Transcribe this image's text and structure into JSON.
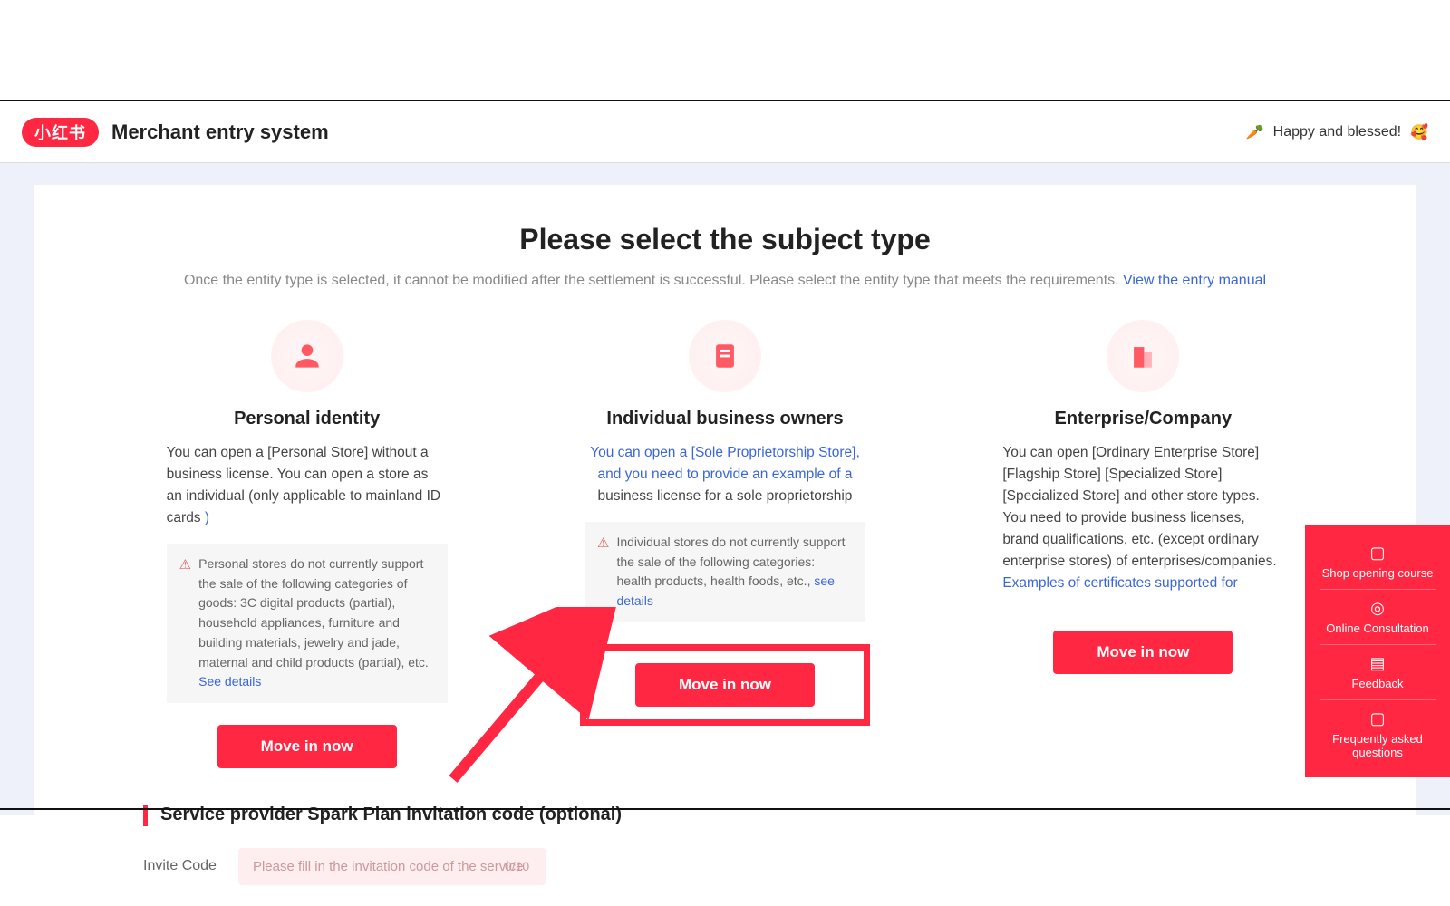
{
  "header": {
    "logo_text": "小红书",
    "title": "Merchant entry system",
    "welcome_icon": "🥕",
    "welcome_text": "Happy and blessed!",
    "welcome_emoji": "🥰"
  },
  "main": {
    "title": "Please select the subject type",
    "subtitle_text": "Once the entity type is selected, it cannot be modified after the settlement is successful. Please select the entity type that meets the requirements. ",
    "subtitle_link": "View the entry manual"
  },
  "cards": {
    "personal": {
      "title": "Personal identity",
      "desc": "You can open a [Personal Store] without a business license. You can open a store as an individual (only applicable to mainland ID cards",
      "desc_link": "  )",
      "warn": "Personal stores do not currently support the sale of the following categories of goods: 3C digital products (partial), household appliances, furniture and building materials, jewelry and jade, maternal and child products (partial), etc.  ",
      "warn_link": "See details",
      "cta": "Move in now"
    },
    "individual": {
      "title": "Individual business owners",
      "desc_blue": "You can open a [Sole Proprietorship Store], and you need to provide an example of a ",
      "desc_black": "business license for a sole proprietorship",
      "warn": "Individual stores do not currently support the sale of the following categories: health products, health foods, etc.,  ",
      "warn_link": "see details",
      "cta": "Move in now"
    },
    "enterprise": {
      "title": "Enterprise/Company",
      "desc": "You can open [Ordinary Enterprise Store] [Flagship Store] [Specialized Store] [Specialized Store] and other store types. You need to provide business licenses, brand qualifications, etc. (except ordinary enterprise stores) of enterprises/companies.  ",
      "desc_link": "Examples of certificates  supported for",
      "cta": "Move in now"
    }
  },
  "invite": {
    "section_title": "Service provider Spark Plan invitation code (optional)",
    "label": "Invite Code",
    "placeholder": "Please fill in the invitation code of the service",
    "counter": "0/10"
  },
  "side_panel": {
    "items": [
      {
        "label": "Shop opening course"
      },
      {
        "label": "Online Consultation"
      },
      {
        "label": "Feedback"
      },
      {
        "label": "Frequently asked questions"
      }
    ]
  }
}
